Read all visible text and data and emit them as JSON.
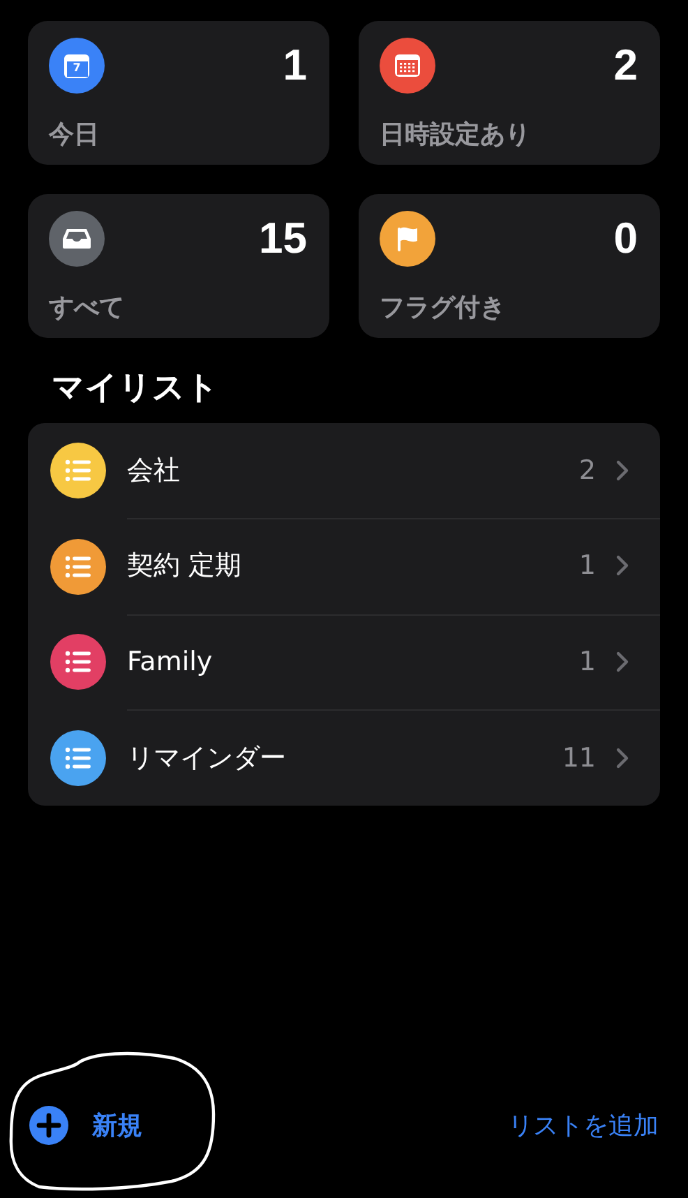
{
  "smart_lists": [
    {
      "kind": "today",
      "label": "今日",
      "count": "1",
      "color": "#3a82f7",
      "icon_text": "7"
    },
    {
      "kind": "scheduled",
      "label": "日時設定あり",
      "count": "2",
      "color": "#eb4d3d"
    },
    {
      "kind": "all",
      "label": "すべて",
      "count": "15",
      "color": "#5f6369"
    },
    {
      "kind": "flagged",
      "label": "フラグ付き",
      "count": "0",
      "color": "#f2a33a"
    }
  ],
  "my_lists": {
    "title": "マイリスト",
    "items": [
      {
        "name": "会社",
        "count": "2",
        "color": "#f7c843"
      },
      {
        "name": "契約 定期",
        "count": "1",
        "color": "#f09a37"
      },
      {
        "name": "Family",
        "count": "1",
        "color": "#e23f64"
      },
      {
        "name": "リマインダー",
        "count": "11",
        "color": "#4aa3f0"
      }
    ]
  },
  "toolbar": {
    "new_label": "新規",
    "add_list": "リストを追加"
  }
}
